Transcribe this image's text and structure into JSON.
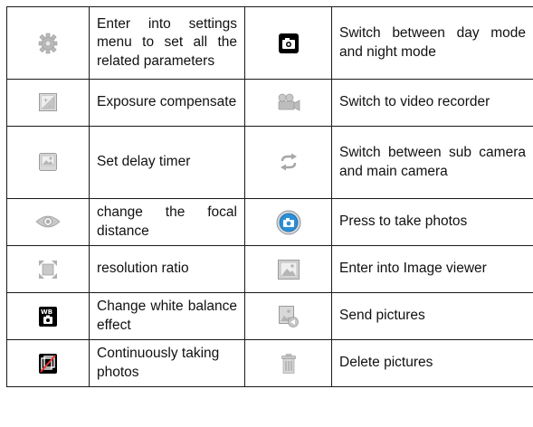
{
  "rows": [
    {
      "left_icon": "settings-gear-icon",
      "left_text": "Enter into settings menu to set all the related parameters",
      "right_icon": "day-night-camera-icon",
      "right_text": "Switch between day mode and night mode"
    },
    {
      "left_icon": "exposure-compensate-icon",
      "left_text": "Exposure compensate",
      "right_icon": "video-recorder-icon",
      "right_text": "Switch to video recorder"
    },
    {
      "left_icon": "delay-timer-icon",
      "left_text": "Set delay timer",
      "right_icon": "switch-camera-icon",
      "right_text": "Switch between sub camera and main camera"
    },
    {
      "left_icon": "focal-distance-eye-icon",
      "left_text": "change the focal distance",
      "right_icon": "shutter-button-icon",
      "right_text": "Press to take photos"
    },
    {
      "left_icon": "resolution-ratio-icon",
      "left_text": "resolution ratio",
      "right_icon": "image-viewer-icon",
      "right_text": "Enter into Image viewer"
    },
    {
      "left_icon": "white-balance-icon",
      "left_text": "Change white balance effect",
      "right_icon": "send-pictures-icon",
      "right_text": "Send pictures"
    },
    {
      "left_icon": "continuous-shooting-icon",
      "left_text": "Continuously taking photos",
      "right_icon": "trash-delete-icon",
      "right_text": "Delete pictures"
    }
  ]
}
